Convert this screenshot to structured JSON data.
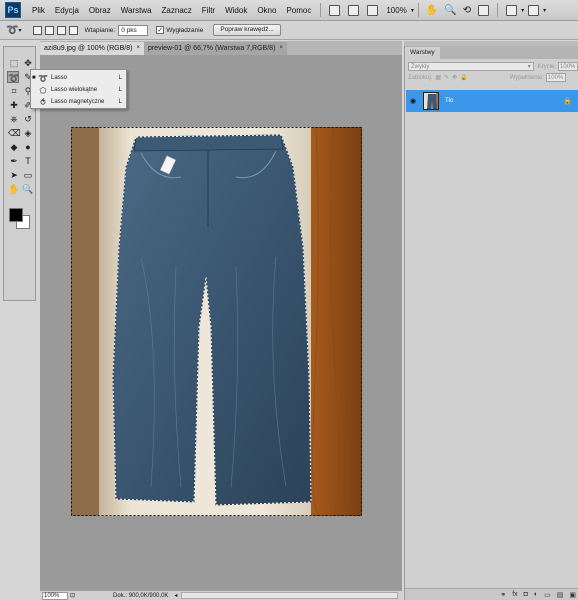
{
  "app": {
    "logo": "Ps"
  },
  "menu": [
    "Plik",
    "Edycja",
    "Obraz",
    "Warstwa",
    "Zaznacz",
    "Filtr",
    "Widok",
    "Okno",
    "Pomoc"
  ],
  "menubar": {
    "zoom": "100%"
  },
  "options": {
    "feather_label": "Wtapianie:",
    "feather_value": "0 pks",
    "antialias_label": "Wygładzanie",
    "antialias_checked": "✓",
    "refine_edge": "Popraw krawędź..."
  },
  "tabs": [
    {
      "label": "azi8u9.jpg @ 100% (RGB/8)",
      "close": "×"
    },
    {
      "label": "preview-01 @ 66,7% (Warstwa 7,RGB/8)",
      "close": "×"
    }
  ],
  "flyout": {
    "items": [
      {
        "icon": "lasso-icon",
        "label": "Lasso",
        "key": "L"
      },
      {
        "icon": "polygonal-lasso-icon",
        "label": "Lasso wielokątne",
        "key": "L"
      },
      {
        "icon": "magnetic-lasso-icon",
        "label": "Lasso magnetyczne",
        "key": "L"
      }
    ],
    "bullet": "■"
  },
  "status": {
    "zoom": "100%",
    "doc": "Dok.: 900,0K/900,0K",
    "arrow": "◂"
  },
  "layers": {
    "tab": "Warstwy",
    "blend_mode": "Zwykły",
    "opacity_label": "Krycie:",
    "opacity_value": "100%",
    "lock_label": "Zablokuj:",
    "fill_label": "Wypełnienie:",
    "fill_value": "100%",
    "layer_name": "Tło",
    "eye": "◉",
    "lock_icon": "🔒",
    "bottom_icons": [
      "⚭",
      "fx",
      "◘",
      "◐",
      "▭",
      "▤",
      "▣"
    ]
  },
  "colors": {
    "accent": "#3b97e9",
    "canvas_bg": "#9a9a9a",
    "panel_bg": "#d0d0d0"
  }
}
